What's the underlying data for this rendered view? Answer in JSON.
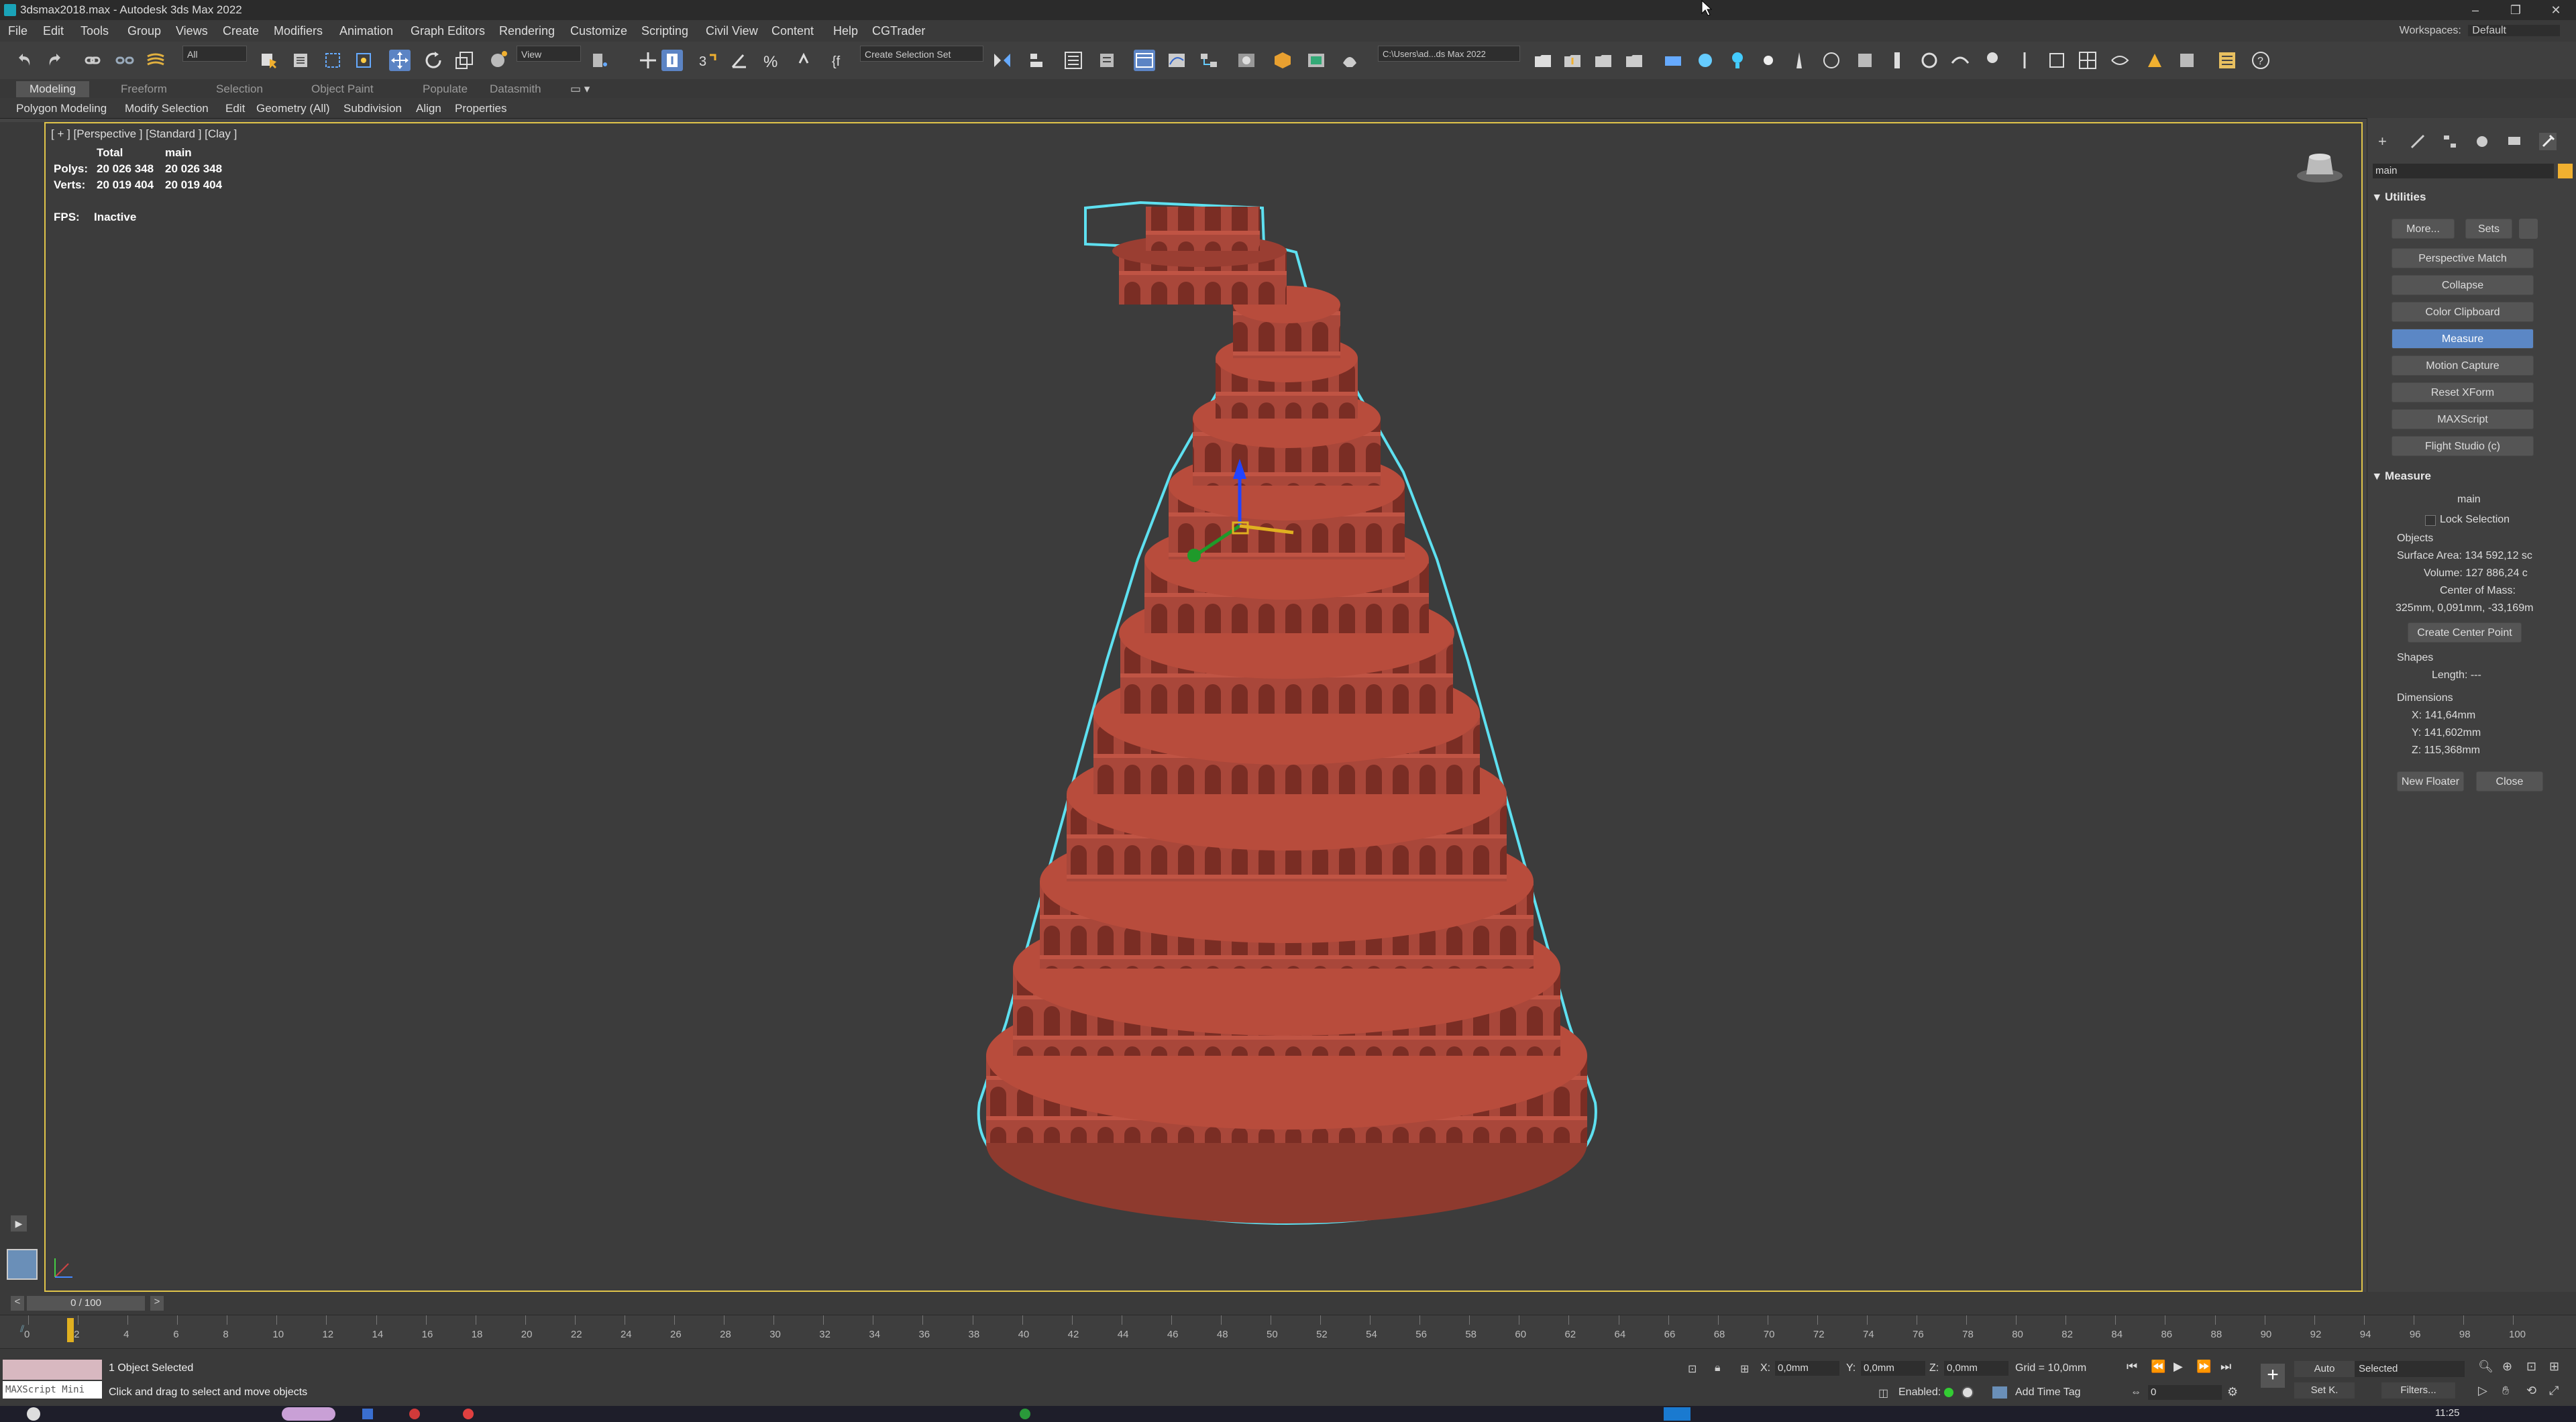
{
  "window": {
    "title": "3dsmax2018.max - Autodesk 3ds Max 2022",
    "controls": [
      "–",
      "❐",
      "✕"
    ]
  },
  "menu": {
    "items": [
      "File",
      "Edit",
      "Tools",
      "Group",
      "Views",
      "Create",
      "Modifiers",
      "Animation",
      "Graph Editors",
      "Rendering",
      "Customize",
      "Scripting",
      "Civil View",
      "Content",
      "Help",
      "CGTrader"
    ],
    "workspaces_label": "Workspaces:",
    "workspaces_value": "Default"
  },
  "toolbar": {
    "selection_filter": "All",
    "reference_coord": "View",
    "named_selection": "Create Selection Set",
    "project_path": "C:\\Users\\ad...ds Max 2022"
  },
  "ribbon": {
    "tabs": [
      "Modeling",
      "Freeform",
      "Selection",
      "Object Paint",
      "Populate",
      "Datasmith"
    ],
    "active_tab": "Modeling",
    "subitems": [
      "Polygon Modeling",
      "Modify Selection",
      "Edit",
      "Geometry (All)",
      "Subdivision",
      "Align",
      "Properties"
    ]
  },
  "viewport": {
    "label": "[ + ] [Perspective ] [Standard ] [Clay ]",
    "stats": {
      "col_total": "Total",
      "col_main": "main",
      "polys_label": "Polys:",
      "polys_total": "20 026 348",
      "polys_main": "20 026 348",
      "verts_label": "Verts:",
      "verts_total": "20 019 404",
      "verts_main": "20 019 404",
      "fps_label": "FPS:",
      "fps_value": "Inactive"
    },
    "model_color": "#b04838",
    "outline_color": "#5ee0f0"
  },
  "command_panel": {
    "name_field": "main",
    "name_color": "#f0b030",
    "utilities_header": "Utilities",
    "more_button": "More...",
    "sets_button": "Sets",
    "utility_buttons": [
      "Perspective Match",
      "Collapse",
      "Color Clipboard",
      "Measure",
      "Motion Capture",
      "Reset XForm",
      "MAXScript",
      "Flight Studio (c)"
    ],
    "selected_utility": "Measure",
    "measure": {
      "header": "Measure",
      "object_name": "main",
      "lock_selection": "Lock Selection",
      "objects_label": "Objects",
      "surface_area": "Surface Area: 134 592,12 sc",
      "volume": "Volume:  127 886,24 c",
      "center_of_mass_label": "Center of Mass:",
      "center_of_mass": "325mm, 0,091mm, -33,169m",
      "create_center_point": "Create Center Point",
      "shapes_label": "Shapes",
      "length": "Length:  ---",
      "dimensions_label": "Dimensions",
      "dim_x": "X:   141,64mm",
      "dim_y": "Y:   141,602mm",
      "dim_z": "Z:   115,368mm",
      "new_floater": "New Floater",
      "close": "Close"
    }
  },
  "timeline": {
    "frame_display": "0 / 100",
    "prev": "<",
    "next": ">",
    "ticks": [
      "0",
      "2",
      "4",
      "6",
      "8",
      "10",
      "12",
      "14",
      "16",
      "18",
      "20",
      "22",
      "24",
      "26",
      "28",
      "30",
      "32",
      "34",
      "36",
      "38",
      "40",
      "42",
      "44",
      "46",
      "48",
      "50",
      "52",
      "54",
      "56",
      "58",
      "60",
      "62",
      "64",
      "66",
      "68",
      "70",
      "72",
      "74",
      "76",
      "78",
      "80",
      "82",
      "84",
      "86",
      "88",
      "90",
      "92",
      "94",
      "96",
      "98",
      "100"
    ]
  },
  "status": {
    "maxscript": "MAXScript Mini",
    "selected_count": "1 Object Selected",
    "prompt": "Click and drag to select and move objects",
    "x_label": "X:",
    "x_value": "0,0mm",
    "y_label": "Y:",
    "y_value": "0,0mm",
    "z_label": "Z:",
    "z_value": "0,0mm",
    "grid": "Grid = 10,0mm",
    "enabled": "Enabled:",
    "add_time_tag": "Add Time Tag",
    "auto": "Auto",
    "set_key": "Set K.",
    "selected_dropdown": "Selected",
    "filters": "Filters...",
    "frame_field": "0"
  },
  "taskbar": {
    "clock": "11:25"
  }
}
